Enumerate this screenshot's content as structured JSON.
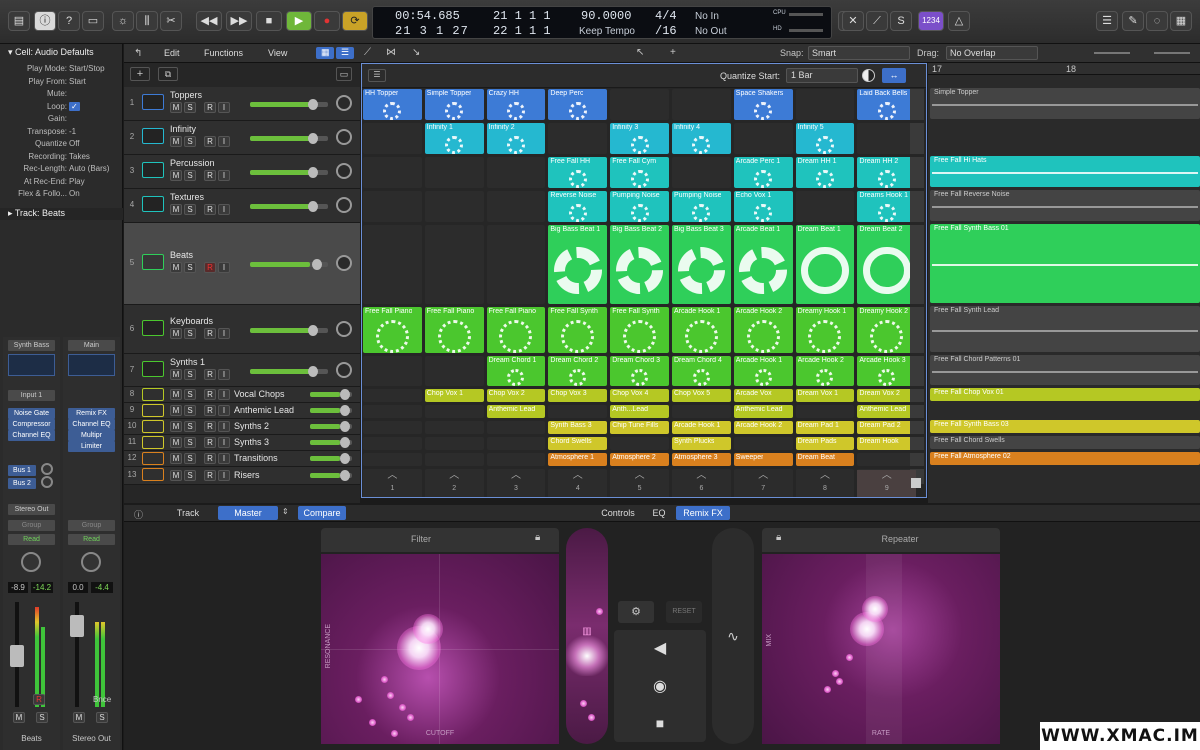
{
  "colors": {
    "blue": "#3d7bd6",
    "cyan": "#25b8d0",
    "teal": "#1fc3bd",
    "green": "#2fcf5a",
    "lime": "#4bc72e",
    "yellowgreen": "#b5c823",
    "yellow": "#cfc72a",
    "orange": "#d9801e",
    "selection": "#6b8fd6"
  },
  "transport": {
    "time": "00:54.685",
    "bars_top": [
      "21",
      "1",
      "1",
      "1"
    ],
    "bars_bottom": [
      "21",
      "3",
      "1",
      "27"
    ],
    "bars_bottom2": [
      "22",
      "1",
      "1",
      "1"
    ],
    "tempo": "90.0000",
    "tempo_mode": "Keep Tempo",
    "signature": "4/4",
    "division": "/16",
    "in": "No In",
    "out": "No Out",
    "cpu": "CPU",
    "hd": "HD",
    "key_cmd": "1234"
  },
  "inspector": {
    "cell_title": "Cell: Audio Defaults",
    "rows": [
      {
        "k": "Play Mode:",
        "v": "Start/Stop"
      },
      {
        "k": "Play From:",
        "v": "Start"
      },
      {
        "k": "Mute:",
        "v": ""
      },
      {
        "k": "Loop:",
        "v": "✓"
      },
      {
        "k": "Gain:",
        "v": ""
      },
      {
        "k": "Transpose:",
        "v": "-1"
      },
      {
        "k": "Quantize",
        "v": "Off"
      },
      {
        "k": "Recording:",
        "v": "Takes"
      },
      {
        "k": "Rec-Length:",
        "v": "Auto (Bars)"
      },
      {
        "k": "At Rec-End:",
        "v": "Play"
      },
      {
        "k": "Flex & Follo...",
        "v": "On"
      }
    ],
    "track_title": "Track:  Beats",
    "strips": [
      {
        "name": "Synth Bass",
        "input": "Input 1",
        "plugins": [
          "Noise Gate",
          "Compressor",
          "Channel EQ"
        ],
        "sends": [
          "Bus 1",
          "Bus 2"
        ],
        "out": "Stereo Out",
        "group": "Group",
        "auto": "Read",
        "vol": "-8.9",
        "peak": "-14.2",
        "label": "Beats"
      },
      {
        "name": "Main",
        "input": "",
        "plugins": [
          "Remix FX",
          "Channel EQ",
          "Multipr",
          "Limiter"
        ],
        "sends": [],
        "out": "",
        "group": "Group",
        "auto": "Read",
        "vol": "0.0",
        "peak": "-4.4",
        "label": "Stereo Out",
        "extra": "Bnce"
      }
    ]
  },
  "menus": {
    "edit": "Edit",
    "functions": "Functions",
    "view": "View",
    "snap_label": "Snap:",
    "snap": "Smart",
    "drag_label": "Drag:",
    "drag": "No Overlap",
    "quantize_label": "Quantize Start:",
    "quantize": "1 Bar"
  },
  "ruler": {
    "m17": "17",
    "m18": "18"
  },
  "tracks": [
    {
      "n": "1",
      "name": "Toppers"
    },
    {
      "n": "2",
      "name": "Infinity"
    },
    {
      "n": "3",
      "name": "Percussion"
    },
    {
      "n": "4",
      "name": "Textures"
    },
    {
      "n": "5",
      "name": "Beats"
    },
    {
      "n": "6",
      "name": "Keyboards"
    },
    {
      "n": "7",
      "name": "Synths 1"
    },
    {
      "n": "8",
      "name": "Vocal Chops"
    },
    {
      "n": "9",
      "name": "Anthemic Lead"
    },
    {
      "n": "10",
      "name": "Synths 2"
    },
    {
      "n": "11",
      "name": "Synths 3"
    },
    {
      "n": "12",
      "name": "Transitions"
    },
    {
      "n": "13",
      "name": "Risers"
    }
  ],
  "cells": [
    [
      "HH Topper",
      "Simple Topper",
      "Crazy HH",
      "Deep Perc",
      "",
      "",
      "Space Shakers",
      "",
      "Laid Back Bells"
    ],
    [
      "",
      "Infinity 1",
      "Infinity 2",
      "",
      "Infinity 3",
      "Infinity 4",
      "",
      "Infinity 5",
      ""
    ],
    [
      "",
      "",
      "",
      "Free Fall HH",
      "Free Fall Cym",
      "",
      "Arcade Perc 1",
      "Dream HH 1",
      "Dream HH 2"
    ],
    [
      "",
      "",
      "",
      "Reverse Noise",
      "Pumping Noise",
      "Pumping Noise",
      "Echo Vox 1",
      "",
      "Dreams Hook 1"
    ],
    [
      "",
      "",
      "",
      "Big Bass Beat 1",
      "Big Bass Beat 2",
      "Big Bass Beat 3",
      "Arcade Beat 1",
      "Dream Beat 1",
      "Dream Beat 2"
    ],
    [
      "Free Fall Piano",
      "Free Fall Piano",
      "Free Fall Piano",
      "Free Fall Synth",
      "Free Fall Synth",
      "Arcade Hook 1",
      "Arcade Hook 2",
      "Dreamy Hook 1",
      "Dreamy Hook 2"
    ],
    [
      "",
      "",
      "Dream Chord 1",
      "Dream Chord 2",
      "Dream Chord 3",
      "Dream Chord 4",
      "Arcade Hook 1",
      "Arcade Hook 2",
      "Arcade Hook 3"
    ],
    [
      "",
      "Chop Vox 1",
      "Chop Vox 2",
      "Chop Vox 3",
      "Chop Vox 4",
      "Chop Vox 5",
      "Arcade Vox",
      "Dream Vox 1",
      "Dream Vox 2"
    ],
    [
      "",
      "",
      "Anthemic Lead",
      "",
      "Anth...Lead",
      "",
      "Anthemic Lead",
      "",
      "Anthemic Lead"
    ],
    [
      "",
      "",
      "",
      "Synth Bass 3",
      "Chip Tune Fills",
      "Arcade Hook 1",
      "Arcade Hook 2",
      "Dream Pad 1",
      "Dream Pad 2"
    ],
    [
      "",
      "",
      "",
      "Chord Swells",
      "",
      "Synth Plucks",
      "",
      "Dream Pads",
      "Dream Hook"
    ],
    [
      "",
      "",
      "",
      "Atmosphere 1",
      "Atmosphere 2",
      "Atmosphere 3",
      "Sweeper",
      "Dream Beat",
      ""
    ],
    [
      "",
      "",
      "",
      "",
      "",
      "",
      "",
      "",
      ""
    ]
  ],
  "scenes": [
    "1",
    "2",
    "3",
    "4",
    "5",
    "6",
    "7",
    "8",
    "9"
  ],
  "regions": [
    {
      "row": 0,
      "label": "Simple Topper"
    },
    {
      "row": 2,
      "label": "Free Fall Hi Hats"
    },
    {
      "row": 3,
      "label": "Free Fall Reverse Noise"
    },
    {
      "row": 4,
      "label": "Free Fall Synth Bass 01"
    },
    {
      "row": 5,
      "label": "Free Fall Synth Lead"
    },
    {
      "row": 6,
      "label": "Free Fall Chord Patterns 01"
    },
    {
      "row": 7,
      "label": "Free Fall Chop Vox 01"
    },
    {
      "row": 9,
      "label": "Free Fall Synth Bass 03"
    },
    {
      "row": 10,
      "label": "Free Fall Chord Swells"
    },
    {
      "row": 11,
      "label": "Free Fall Atmosphere 02"
    }
  ],
  "bottom": {
    "track_tab": "Track",
    "master_tab": "Master",
    "compare": "Compare",
    "tabs": [
      "Controls",
      "EQ",
      "Remix FX"
    ],
    "filter": "Filter",
    "resonance": "RESONANCE",
    "cutoff": "CUTOFF",
    "reset": "RESET",
    "repeater": "Repeater",
    "mix": "MIX",
    "rate": "RATE"
  },
  "watermark": "WWW.XMAC.IM"
}
